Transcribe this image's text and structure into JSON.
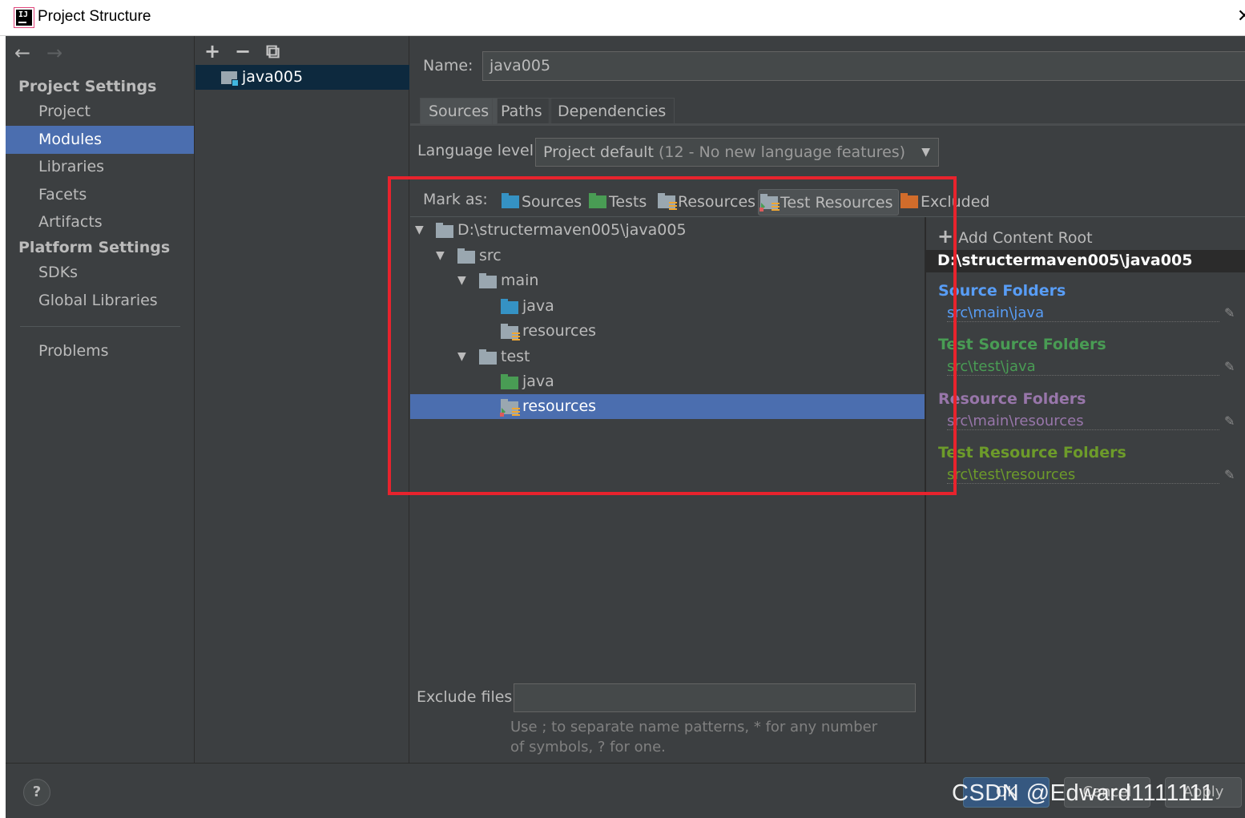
{
  "window": {
    "title": "Project Structure",
    "close_glyph": "✕",
    "logo_text": "IJ"
  },
  "nav": {
    "back": "←",
    "forward": "→"
  },
  "sidebar": {
    "project_settings_heading": "Project Settings",
    "platform_settings_heading": "Platform Settings",
    "items": [
      {
        "label": "Project"
      },
      {
        "label": "Modules"
      },
      {
        "label": "Libraries"
      },
      {
        "label": "Facets"
      },
      {
        "label": "Artifacts"
      },
      {
        "label": "SDKs"
      },
      {
        "label": "Global Libraries"
      },
      {
        "label": "Problems"
      }
    ],
    "selected": "Modules"
  },
  "module_toolbar": {
    "add": "+",
    "remove": "−",
    "copy": "⧉"
  },
  "modules": [
    {
      "label": "java005"
    }
  ],
  "name_field": {
    "label": "Name:",
    "value": "java005"
  },
  "tabs": [
    {
      "label": "Sources"
    },
    {
      "label": "Paths"
    },
    {
      "label": "Dependencies"
    }
  ],
  "active_tab": "Sources",
  "language_level": {
    "label": "Language level:",
    "value_main": "Project default",
    "value_detail": "(12 - No new language features)",
    "caret": "▼"
  },
  "mark_as": {
    "label": "Mark as:",
    "buttons": [
      {
        "label": "Sources",
        "icon": "sources-folder-icon"
      },
      {
        "label": "Tests",
        "icon": "tests-folder-icon"
      },
      {
        "label": "Resources",
        "icon": "resources-folder-icon"
      },
      {
        "label": "Test Resources",
        "icon": "test-resources-folder-icon"
      },
      {
        "label": "Excluded",
        "icon": "excluded-folder-icon"
      }
    ],
    "selected": "Test Resources"
  },
  "tree": {
    "expanded_glyph": "▼",
    "rows": [
      {
        "label": "D:\\structermaven005\\java005"
      },
      {
        "label": "src"
      },
      {
        "label": "main"
      },
      {
        "label": "java"
      },
      {
        "label": "resources"
      },
      {
        "label": "test"
      },
      {
        "label": "java"
      },
      {
        "label": "resources"
      }
    ],
    "selected_row": 7
  },
  "content_root": {
    "add_label": "Add Content Root",
    "add_icon": "+",
    "path": "D:\\structermaven005\\java005",
    "pencil": "✎",
    "categories": [
      {
        "title": "Source Folders",
        "path": "src\\main\\java",
        "color": "#589df6"
      },
      {
        "title": "Test Source Folders",
        "path": "src\\test\\java",
        "color": "#499c54"
      },
      {
        "title": "Resource Folders",
        "path": "src\\main\\resources",
        "color": "#9876aa"
      },
      {
        "title": "Test Resource Folders",
        "path": "src\\test\\resources",
        "color": "#6d9b2a"
      }
    ]
  },
  "exclude": {
    "label": "Exclude files:",
    "value": "",
    "hint": "Use ; to separate name patterns, * for any number of symbols, ? for one."
  },
  "buttons": {
    "help": "?",
    "ok": "OK",
    "cancel": "Cancel",
    "apply": "Apply"
  },
  "watermark": "CSDN @Edward1111111",
  "colors": {
    "accent": "#4b6eaf",
    "highlight": "#e8232d",
    "background": "#3c3f41"
  }
}
